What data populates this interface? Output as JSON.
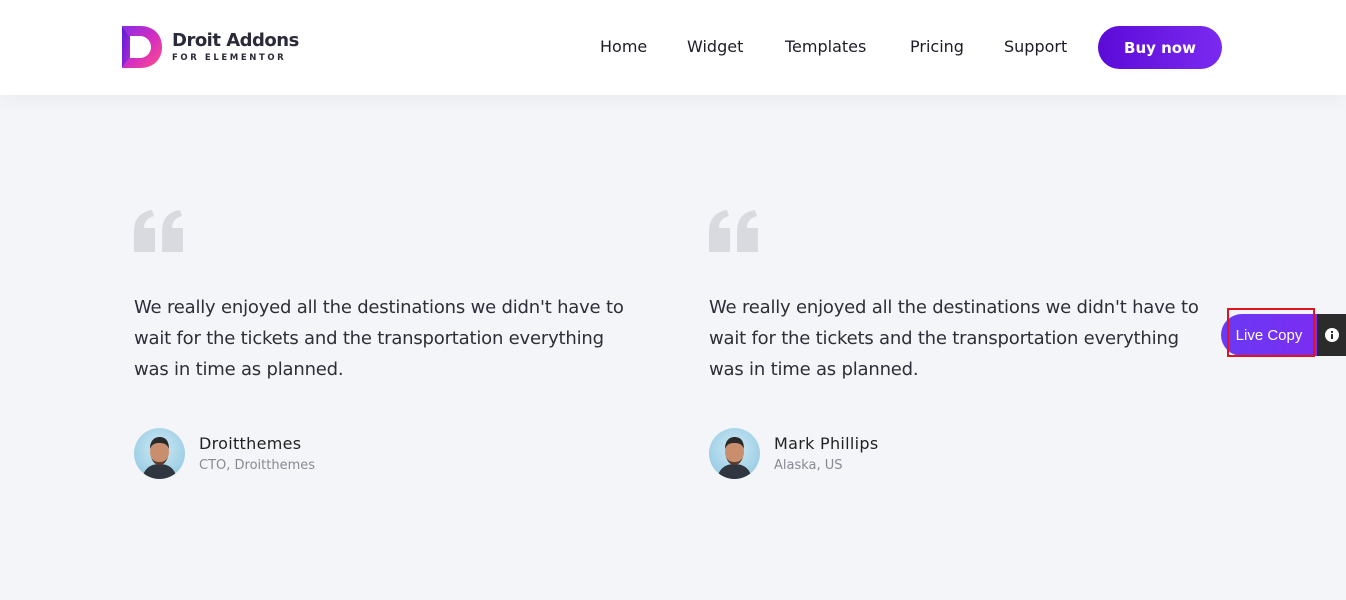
{
  "header": {
    "logo": {
      "title": "Droit Addons",
      "subtitle": "FOR ELEMENTOR"
    },
    "nav": [
      "Home",
      "Widget",
      "Templates",
      "Pricing",
      "Support"
    ],
    "cta_label": "Buy now"
  },
  "testimonials": [
    {
      "quote": "We really enjoyed all the destinations we didn't have to wait for the tickets and the transportation everything was in time as planned.",
      "author_name": "Droitthemes",
      "author_role": "CTO, Droitthemes"
    },
    {
      "quote": "We really enjoyed all the destinations we didn't have to wait for the tickets and the transportation everything was in time as planned.",
      "author_name": "Mark Phillips",
      "author_role": "Alaska, US"
    }
  ],
  "live_copy": {
    "label": "Live Copy",
    "info_icon": "info-icon"
  },
  "colors": {
    "brand_purple": "#5b0bd6",
    "page_bg": "#f4f5f8",
    "quote_icon": "#d9dadf",
    "highlight": "#e0141e"
  }
}
